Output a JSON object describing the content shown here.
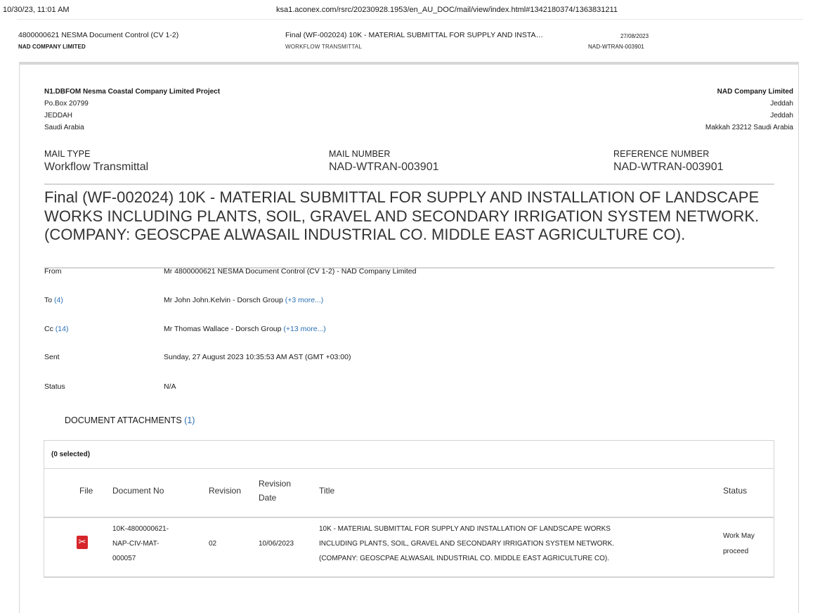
{
  "print_header": {
    "datetime": "10/30/23, 11:01 AM",
    "url": "ksa1.aconex.com/rsrc/20230928.1953/en_AU_DOC/mail/view/index.html#1342180374/1363831211"
  },
  "mail_header": {
    "sender": "4800000621 NESMA Document Control (CV 1-2)",
    "org": "NAD COMPANY LIMITED",
    "subject": "Final (WF-002024) 10K - MATERIAL SUBMITTAL FOR SUPPLY AND INSTA…",
    "type": "WORKFLOW TRANSMITTAL",
    "date": "27/08/2023",
    "number": "NAD-WTRAN-003901"
  },
  "address_left": {
    "name": "N1.DBFOM Nesma Coastal Company Limited Project",
    "line1": "Po.Box 20799",
    "line2": "JEDDAH",
    "line3": "Saudi Arabia"
  },
  "address_right": {
    "name": "NAD Company Limited",
    "line1": "Jeddah",
    "line2": "Jeddah",
    "line3": "Makkah 23212 Saudi Arabia"
  },
  "meta": {
    "mail_type_label": "MAIL TYPE",
    "mail_type": "Workflow Transmittal",
    "mail_number_label": "MAIL NUMBER",
    "mail_number": "NAD-WTRAN-003901",
    "reference_label": "REFERENCE NUMBER",
    "reference": "NAD-WTRAN-003901"
  },
  "subject": "Final (WF-002024) 10K - MATERIAL SUBMITTAL FOR SUPPLY AND INSTALLATION OF LANDSCAPE WORKS INCLUDING PLANTS, SOIL, GRAVEL AND SECONDARY IRRIGATION SYSTEM NETWORK. (COMPANY: GEOSCPAE ALWASAIL INDUSTRIAL CO. MIDDLE EAST AGRICULTURE CO).",
  "fields": {
    "from_label": "From",
    "from_value": "Mr 4800000621 NESMA Document Control (CV 1-2) - NAD Company Limited",
    "to_label": "To",
    "to_count": "(4)",
    "to_value": "Mr John John.Kelvin - Dorsch Group",
    "to_more": "(+3 more...)",
    "cc_label": "Cc",
    "cc_count": "(14)",
    "cc_value": "Mr Thomas Wallace - Dorsch Group",
    "cc_more": "(+13 more...)",
    "sent_label": "Sent",
    "sent_value": "Sunday, 27 August 2023 10:35:53 AM AST (GMT +03:00)",
    "status_label": "Status",
    "status_value": "N/A"
  },
  "attachments": {
    "title": "DOCUMENT ATTACHMENTS",
    "count": "(1)",
    "selected": "(0 selected)",
    "columns": {
      "file": "File",
      "doc_no": "Document No",
      "revision": "Revision",
      "revision_date_1": "Revision",
      "revision_date_2": "Date",
      "title": "Title",
      "status": "Status"
    },
    "rows": [
      {
        "file_icon": "pdf-icon",
        "doc_no_1": "10K-4800000621-",
        "doc_no_2": "NAP-CIV-MAT-",
        "doc_no_3": "000057",
        "revision": "02",
        "revision_date": "10/06/2023",
        "title_1": "10K - MATERIAL SUBMITTAL FOR SUPPLY AND INSTALLATION OF LANDSCAPE WORKS",
        "title_2": "INCLUDING PLANTS, SOIL, GRAVEL AND SECONDARY IRRIGATION SYSTEM NETWORK.",
        "title_3": "(COMPANY: GEOSCPAE ALWASAIL INDUSTRIAL CO. MIDDLE EAST AGRICULTURE CO).",
        "status_1": "Work May",
        "status_2": "proceed"
      }
    ]
  },
  "colors": {
    "link": "#2a6fb2",
    "pdf_red": "#d6262b",
    "rule": "#d4d4d4"
  }
}
